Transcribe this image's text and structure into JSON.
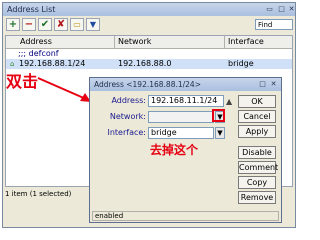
{
  "main_window": {
    "title": "Address List",
    "find_placeholder": "Find",
    "columns": [
      "Address",
      "Network",
      "Interface"
    ],
    "comment_row": ";;; defconf",
    "rows": [
      {
        "address": "192.168.88.1/24",
        "network": "192.168.88.0",
        "interface": "bridge"
      }
    ],
    "status": "1 item (1 selected)"
  },
  "annotations": {
    "double_click": "双击",
    "remove_this": "去掉这个",
    "color": "#e60012"
  },
  "dialog": {
    "title": "Address <192.168.88.1/24>",
    "address_label": "Address:",
    "address_value": "192.168.11.1/24",
    "network_label": "Network:",
    "network_value": "",
    "interface_label": "Interface:",
    "interface_value": "bridge",
    "buttons": [
      "OK",
      "Cancel",
      "Apply",
      "Disable",
      "Comment",
      "Copy",
      "Remove"
    ],
    "status": "enabled"
  }
}
